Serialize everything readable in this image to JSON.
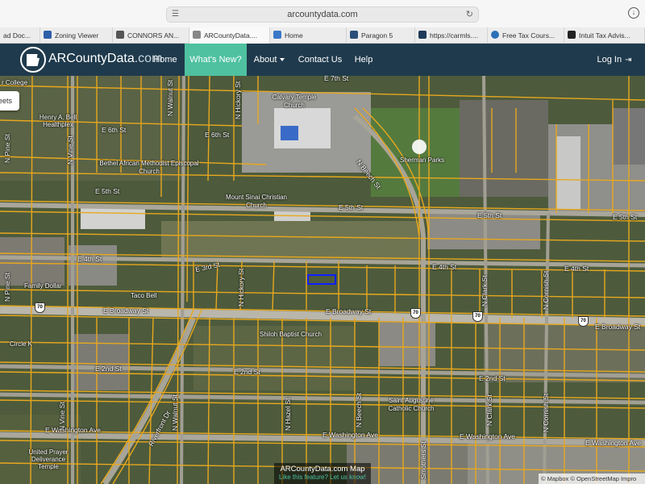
{
  "browser": {
    "url": "arcountydata.com",
    "tabs": [
      {
        "label": "ad Doc...",
        "color": "#5b7fc7"
      },
      {
        "label": "Zoning Viewer",
        "color": "#2d5fa8"
      },
      {
        "label": "CONNORS AN...",
        "color": "#555555"
      },
      {
        "label": "ARCountyData....",
        "color": "#888888"
      },
      {
        "label": "Home",
        "color": "#3a78c8"
      },
      {
        "label": "Paragon 5",
        "color": "#2a4f7a"
      },
      {
        "label": "https://carmls....",
        "color": "#1f3a5a"
      },
      {
        "label": "Free Tax Cours...",
        "color": "#2b6fb8"
      },
      {
        "label": "Intuit Tax Advis...",
        "color": "#222222"
      }
    ]
  },
  "site": {
    "logo_bold": "ARCounty",
    "logo_mid": "Data",
    "logo_tail": ".com",
    "nav": [
      "Home",
      "What's New?",
      "About",
      "Contact Us",
      "Help"
    ],
    "login": "Log In",
    "colors": {
      "nav_bg": "#1f3a4c",
      "active": "#4fc1a0"
    }
  },
  "map": {
    "streets_button": "eets",
    "places": [
      "r College",
      "Henry A. Bell Healthplex",
      "Calvary Temple Church",
      "Sherman Parks",
      "Bethel African Methodist Episcopal Church",
      "Mount Sinai Christian Church",
      "Family Dollar",
      "Taco Bell",
      "Shiloh Baptist Church",
      "Circle K",
      "Saint Augustine Catholic Church",
      "United Prayer Deliverance Temple"
    ],
    "streets": [
      "E 7th St",
      "E 6th St",
      "E 5th St",
      "E 4th St",
      "E 3rd St",
      "E 2nd St",
      "E Broadway St",
      "E Washington Ave",
      "N Walnut St",
      "N Hickory St",
      "N Beech St",
      "N Clark St",
      "N Cornish St",
      "N Vine St",
      "N Pine St",
      "N Hazel St",
      "Riverfront Dr",
      "Smothers St"
    ],
    "route_number": "70",
    "footer_title": "ARCountyData.com Map",
    "footer_link": "Like this feature? Let us know!",
    "attribution": "© Mapbox © OpenStreetMap  Impro"
  }
}
